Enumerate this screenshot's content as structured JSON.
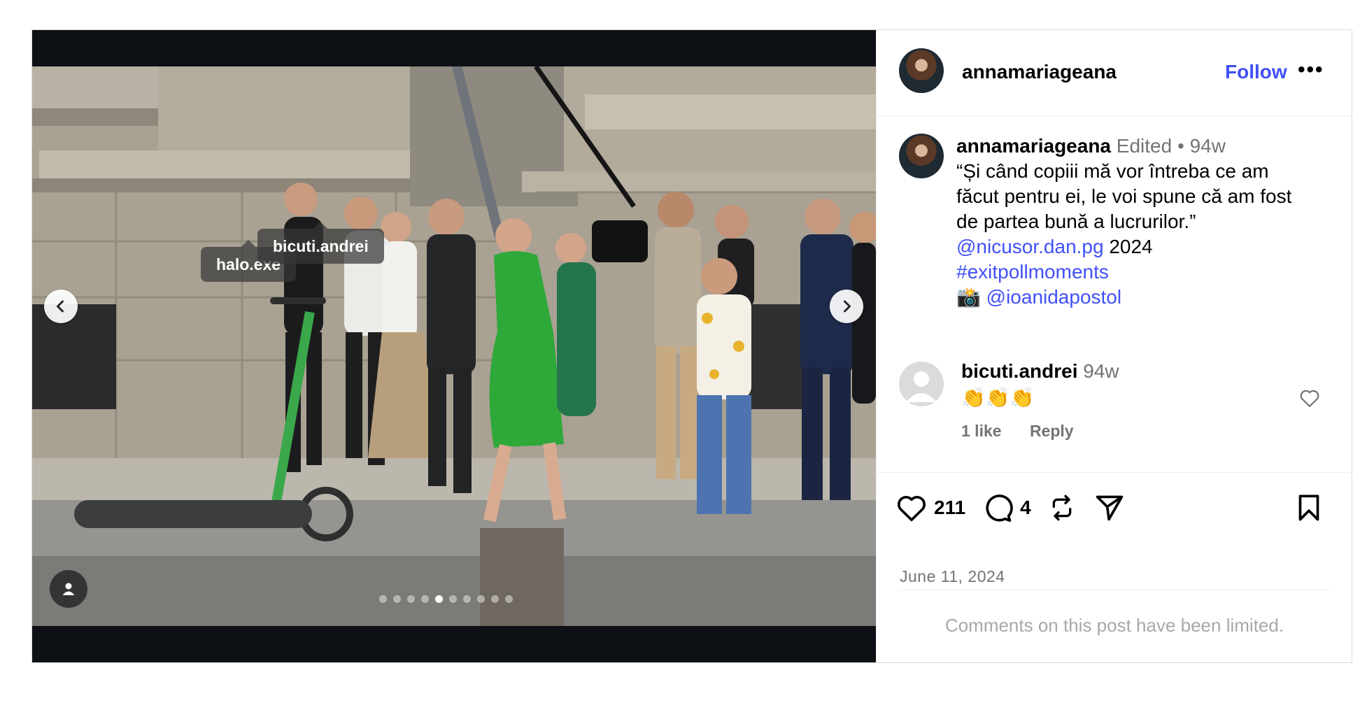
{
  "post": {
    "username": "annamariageana",
    "follow_label": "Follow",
    "more_label": "•••",
    "caption": {
      "username": "annamariageana",
      "edited": "Edited",
      "separator": "•",
      "age": "94w",
      "text_line1": "“Și când copiii mă vor întreba ce am",
      "text_line2": "făcut pentru ei, le voi spune că am fost",
      "text_line3": "de partea bună a lucrurilor.”",
      "mention1": "@nicusor.dan.pg",
      "year": "2024",
      "hashtag": "#exitpollmoments",
      "camera_emoji": "📸",
      "mention2": "@ioanidapostol"
    },
    "comment": {
      "username": "bicuti.andrei",
      "age": "94w",
      "text": "👏👏👏",
      "likes_label": "1 like",
      "reply_label": "Reply"
    },
    "likes_count": "211",
    "comments_count": "4",
    "date": "June 11, 2024",
    "comments_limited": "Comments on this post have been limited."
  },
  "media": {
    "tags": [
      {
        "label": "halo.exe"
      },
      {
        "label": "bicuti.andrei"
      }
    ],
    "carousel": {
      "total": 11,
      "active_index": 4
    }
  },
  "colors": {
    "link": "#4150f7",
    "muted": "#737373",
    "dress_green": "#2fa83a"
  },
  "icons": [
    "chevron-left-icon",
    "chevron-right-icon",
    "person-icon",
    "heart-icon",
    "comment-icon",
    "repost-icon",
    "share-icon",
    "bookmark-icon",
    "more-icon"
  ]
}
